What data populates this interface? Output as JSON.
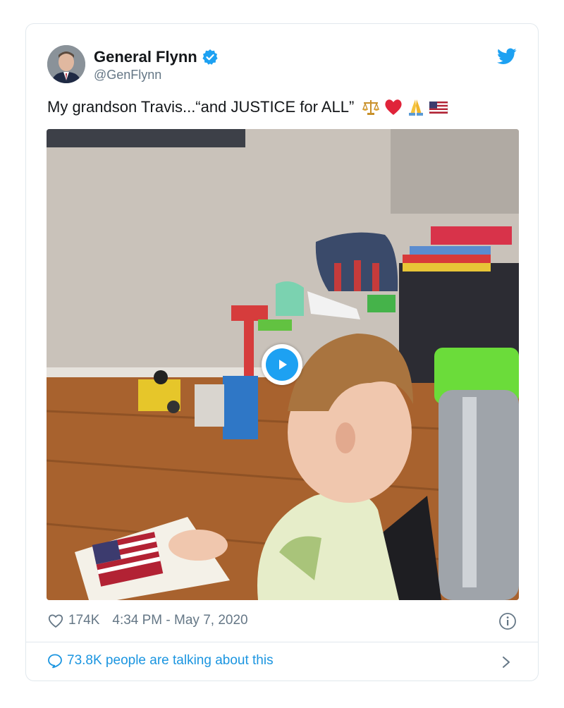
{
  "tweet": {
    "display_name": "General Flynn",
    "handle": "@GenFlynn",
    "text": "My grandson Travis...“and JUSTICE for ALL”",
    "emojis": [
      "scales-icon",
      "heart-icon",
      "praying-hands-icon",
      "us-flag-icon"
    ],
    "likes": "174K",
    "timestamp": "4:34 PM - May 7, 2020",
    "talking": "73.8K people are talking about this"
  },
  "colors": {
    "accent": "#1da1f2",
    "link": "#1b95e0",
    "muted": "#657786",
    "border": "#e1e8ed"
  },
  "media": {
    "type": "video",
    "play_icon": "play-icon"
  }
}
